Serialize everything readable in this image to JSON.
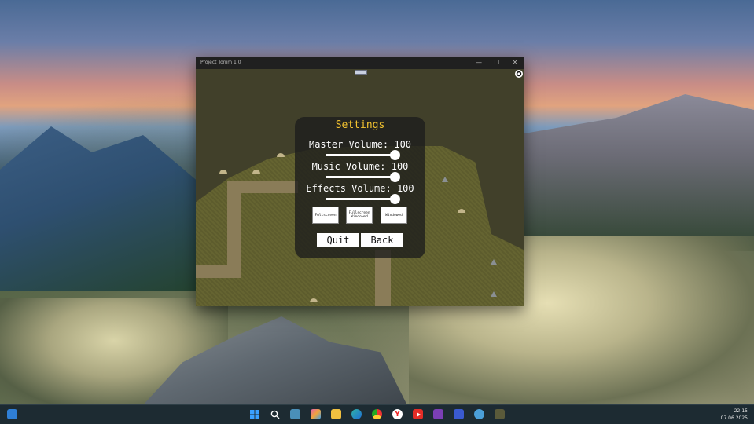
{
  "window": {
    "title": "Project Tonim 1.0",
    "controls": {
      "minimize": "—",
      "maximize": "☐",
      "close": "✕"
    }
  },
  "settings": {
    "title": "Settings",
    "master_volume": {
      "label": "Master Volume: 100",
      "value": 100
    },
    "music_volume": {
      "label": "Music Volume: 100",
      "value": 100
    },
    "effects_volume": {
      "label": "Effects Volume: 100",
      "value": 100
    },
    "modes": {
      "fullscreen": "Fullscreen",
      "fullscreen_windowed": "Fullscreen Windowed",
      "windowed": "Windowed"
    },
    "quit": "Quit",
    "back": "Back"
  },
  "taskbar": {
    "time": "22:15",
    "date": "07.06.2025",
    "icons": [
      "widgets-icon",
      "start-icon",
      "search-icon",
      "task-view-icon",
      "copilot-icon",
      "file-explorer-icon",
      "edge-icon",
      "chrome-icon",
      "yandex-icon",
      "youtube-icon",
      "visual-studio-icon",
      "save-app-icon",
      "network-app-icon",
      "game-app-icon"
    ]
  },
  "colors": {
    "settings_title": "#f2c230",
    "panel_bg": "rgba(28,28,28,0.78)",
    "game_bg": "#41402a",
    "grass": "#656431",
    "taskbar": "#1d2b32"
  }
}
